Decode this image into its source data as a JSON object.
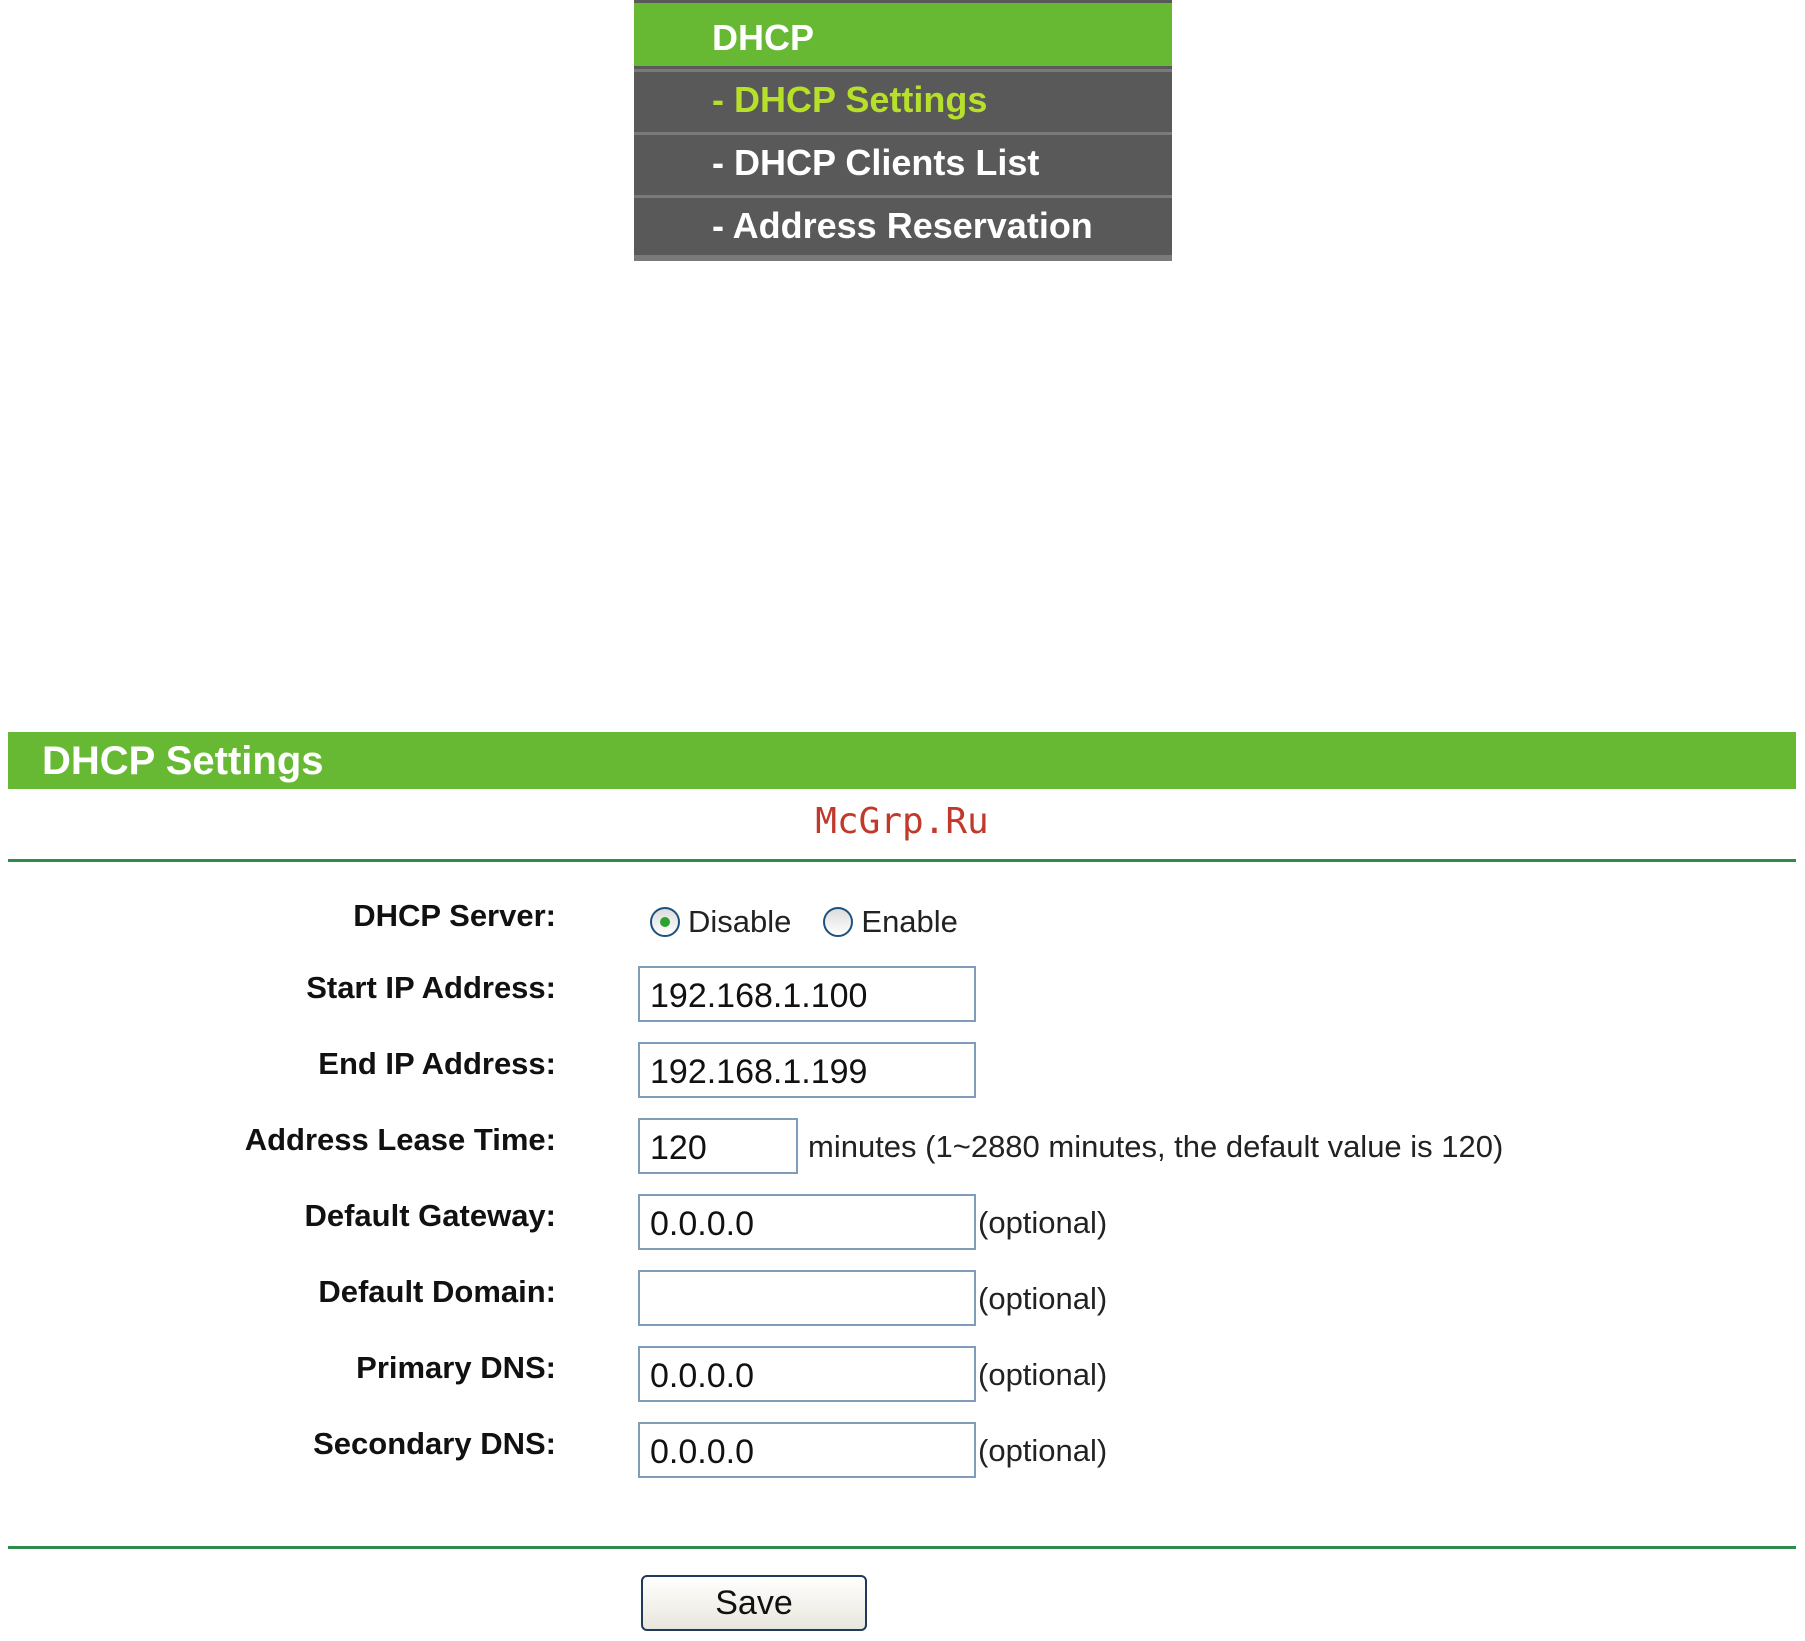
{
  "menu": {
    "header": "DHCP",
    "items": [
      {
        "label": "- DHCP Settings",
        "active": true
      },
      {
        "label": "- DHCP Clients List",
        "active": false
      },
      {
        "label": "- Address Reservation",
        "active": false
      }
    ]
  },
  "panel": {
    "title": "DHCP Settings",
    "watermark": "McGrp.Ru"
  },
  "form": {
    "dhcp_server": {
      "label": "DHCP Server:",
      "options": [
        "Disable",
        "Enable"
      ],
      "selected": "Disable"
    },
    "start_ip": {
      "label": "Start IP Address:",
      "value": "192.168.1.100"
    },
    "end_ip": {
      "label": "End IP Address:",
      "value": "192.168.1.199"
    },
    "lease_time": {
      "label": "Address Lease Time:",
      "value": "120",
      "hint": "minutes (1~2880 minutes, the default value is 120)"
    },
    "default_gateway": {
      "label": "Default Gateway:",
      "value": "0.0.0.0",
      "hint": "(optional)"
    },
    "default_domain": {
      "label": "Default Domain:",
      "value": "",
      "hint": "(optional)"
    },
    "primary_dns": {
      "label": "Primary DNS:",
      "value": "0.0.0.0",
      "hint": "(optional)"
    },
    "secondary_dns": {
      "label": "Secondary DNS:",
      "value": "0.0.0.0",
      "hint": "(optional)"
    }
  },
  "actions": {
    "save_label": "Save"
  },
  "colors": {
    "accent_green": "#67b933",
    "menu_gray": "#595959",
    "active_item": "#b6e02a",
    "rule_green": "#2f8b4a",
    "watermark_red": "#c0392b"
  }
}
